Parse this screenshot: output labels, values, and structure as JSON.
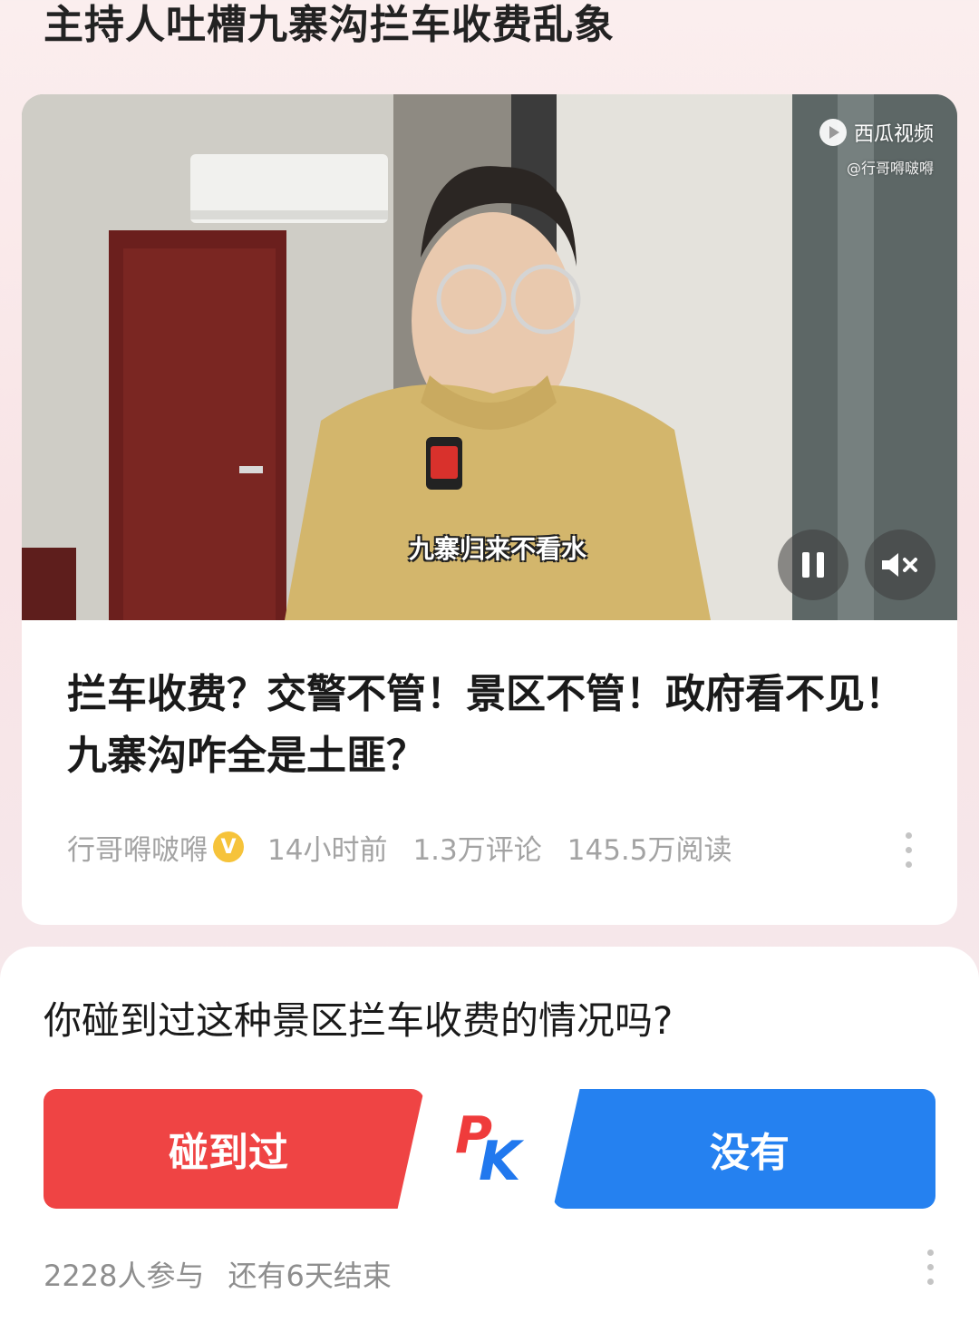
{
  "topic": {
    "title": "主持人吐槽九寨沟拦车收费乱象"
  },
  "video": {
    "watermark_brand": "西瓜视频",
    "watermark_handle": "@行哥嘚啵嘚",
    "subtitle": "九寨归来不看水",
    "pause_icon": "pause-icon",
    "mute_icon": "mute-icon"
  },
  "article": {
    "title": "拦车收费？交警不管！景区不管！政府看不见！九寨沟咋全是土匪？",
    "author": "行哥嘚啵嘚",
    "verified_badge": "V",
    "time": "14小时前",
    "comments": "1.3万评论",
    "reads": "145.5万阅读"
  },
  "poll": {
    "question": "你碰到过这种景区拦车收费的情况吗?",
    "option_yes": "碰到过",
    "option_no": "没有",
    "pk_p": "P",
    "pk_k": "K",
    "participants": "2228人参与",
    "remaining": "还有6天结束",
    "colors": {
      "yes": "#ef4444",
      "no": "#2581f0"
    }
  }
}
